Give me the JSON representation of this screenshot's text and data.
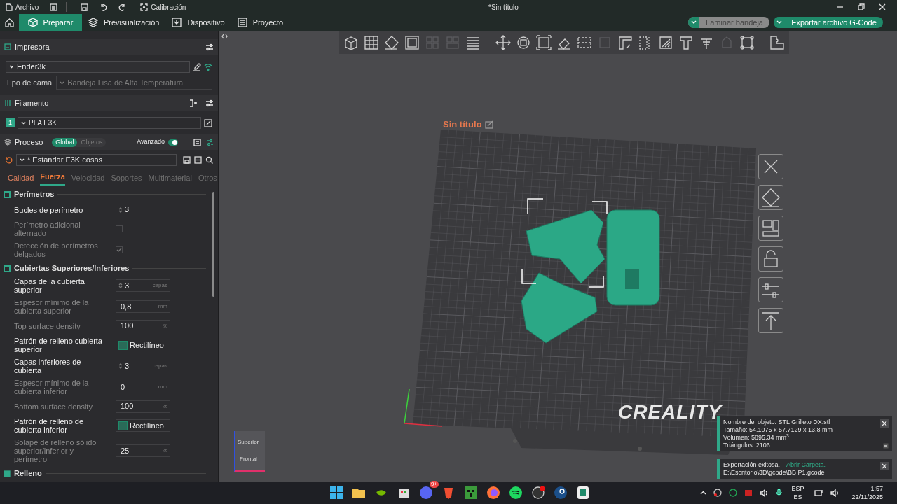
{
  "title_bar": {
    "file_menu": "Archivo",
    "calibration": "Calibración",
    "title": "*Sin título"
  },
  "nav": {
    "tabs": [
      {
        "label": "Preparar",
        "selected": true
      },
      {
        "label": "Previsualización",
        "selected": false
      },
      {
        "label": "Dispositivo",
        "selected": false
      },
      {
        "label": "Proyecto",
        "selected": false
      }
    ],
    "slice_button": {
      "label": "Laminar bandeja",
      "disabled": true
    },
    "export_button": {
      "label": "Exportar archivo G-Code",
      "disabled": false
    }
  },
  "printer": {
    "heading": "Impresora",
    "name": "Ender3k",
    "bed_label": "Tipo de cama",
    "bed_type": "Bandeja Lisa de Alta Temperatura"
  },
  "filament": {
    "heading": "Filamento",
    "items": [
      {
        "index": "1",
        "name": "PLA E3K",
        "color": "#2fa889"
      }
    ]
  },
  "process": {
    "heading": "Proceso",
    "scopes": [
      {
        "label": "Global",
        "selected": true
      },
      {
        "label": "Objetos",
        "selected": false
      }
    ],
    "advanced_label": "Avanzado",
    "advanced_on": true,
    "preset": "* Estandar E3K cosas",
    "tabs": [
      {
        "label": "Calidad",
        "selected": false,
        "modified": true
      },
      {
        "label": "Fuerza",
        "selected": true,
        "modified": true
      },
      {
        "label": "Velocidad",
        "selected": false,
        "modified": false
      },
      {
        "label": "Soportes",
        "selected": false,
        "modified": false
      },
      {
        "label": "Multimaterial",
        "selected": false,
        "modified": false
      },
      {
        "label": "Otros",
        "selected": false,
        "modified": false
      }
    ],
    "sections": [
      {
        "title": "Perímetros",
        "settings": [
          {
            "kind": "spin",
            "label": "Bucles de perímetro",
            "value": "3",
            "modified": true
          },
          {
            "kind": "checkbox",
            "label": "Perímetro adicional alternado",
            "checked": false,
            "modified": false
          },
          {
            "kind": "checkbox",
            "label": "Detección de perímetros delgados",
            "checked": true,
            "modified": false
          }
        ]
      },
      {
        "title": "Cubiertas Superiores/Inferiores",
        "settings": [
          {
            "kind": "spin",
            "label": "Capas de la cubierta superior",
            "value": "3",
            "unit": "capas",
            "modified": true
          },
          {
            "kind": "number",
            "label": "Espesor mínimo de la cubierta superior",
            "value": "0,8",
            "unit": "mm",
            "modified": false
          },
          {
            "kind": "number",
            "label": "Top surface density",
            "value": "100",
            "unit": "%",
            "modified": false
          },
          {
            "kind": "pattern",
            "label": "Patrón de relleno cubierta superior",
            "value": "Rectilíneo",
            "modified": true
          },
          {
            "kind": "spin",
            "label": "Capas inferiores de cubierta",
            "value": "3",
            "unit": "capas",
            "modified": true
          },
          {
            "kind": "number",
            "label": "Espesor mínimo de la cubierta inferior",
            "value": "0",
            "unit": "mm",
            "modified": false
          },
          {
            "kind": "number",
            "label": "Bottom surface density",
            "value": "100",
            "unit": "%",
            "modified": false
          },
          {
            "kind": "pattern",
            "label": "Patrón de relleno de cubierta inferior",
            "value": "Rectilíneo",
            "modified": true
          },
          {
            "kind": "number",
            "label": "Solape de relleno sólido superior/inferior y perímetro",
            "value": "25",
            "unit": "%",
            "modified": false
          }
        ]
      },
      {
        "title": "Relleno"
      }
    ]
  },
  "toolbar_tools": [
    {
      "disabled": false
    },
    {
      "disabled": false
    },
    {
      "disabled": false
    },
    {
      "disabled": false
    },
    {
      "disabled": true
    },
    {
      "disabled": true
    },
    {
      "disabled": false
    },
    {
      "disabled": false
    },
    {
      "disabled": false
    },
    {
      "disabled": false
    },
    {
      "disabled": false
    },
    {
      "disabled": false
    },
    {
      "disabled": true
    },
    {
      "disabled": false
    },
    {
      "disabled": false
    },
    {
      "disabled": false
    },
    {
      "disabled": false
    },
    {
      "disabled": false
    },
    {
      "disabled": true
    },
    {
      "disabled": false
    },
    {
      "disabled": false
    }
  ],
  "viewport": {
    "plate_name": "Sin título",
    "bed_logo": "CREALITY",
    "view_cube": {
      "top": "Superior",
      "front": "Frontal"
    }
  },
  "notifications": [
    {
      "kind": "info",
      "lines": [
        "Nombre del objeto: STL Grilleto DX.stl",
        "Tamaño: 54.1075 x 57.7129 x 13.8 mm",
        "Volumen: 5895.34 mm$^{3}$",
        "Triángulos: 2106"
      ]
    },
    {
      "kind": "export",
      "text": "Exportación exitosa.",
      "link": "Abrir Carpeta.",
      "path": "E:\\Escritorio\\3D\\gcode\\BB P1.gcode"
    }
  ],
  "taskbar": {
    "badge": "9+",
    "language": "ESP",
    "layout": "ES",
    "time": "1:57",
    "date": "22/11/2025"
  }
}
